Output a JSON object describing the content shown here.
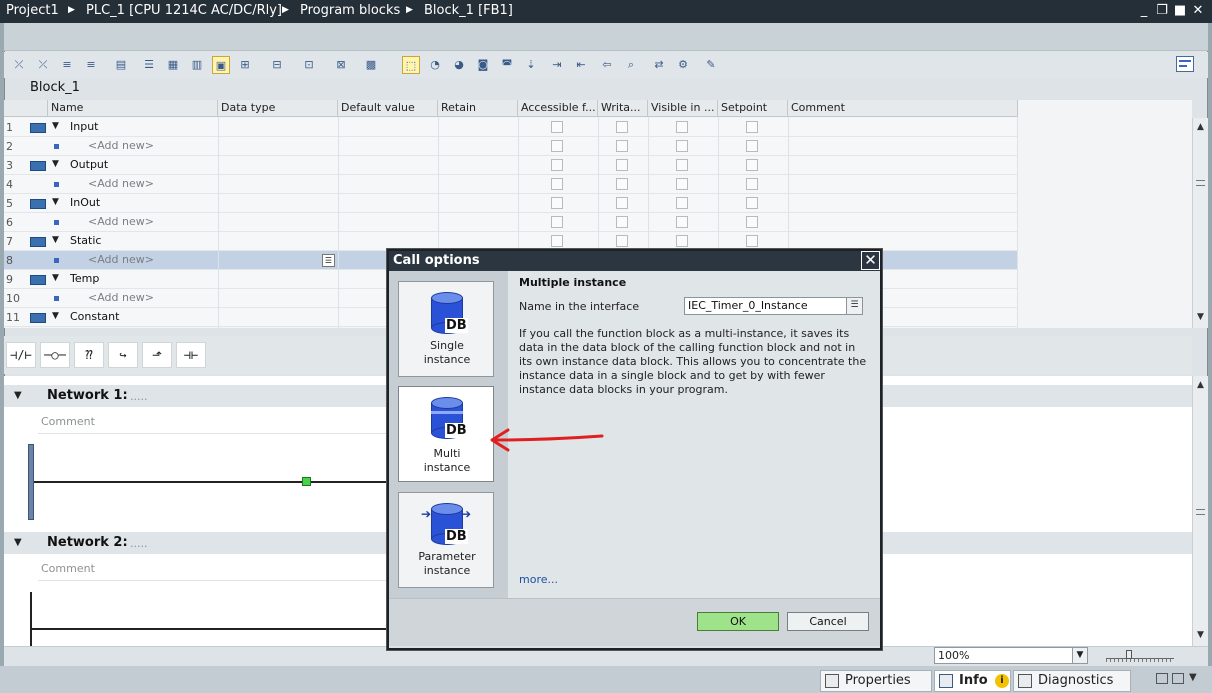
{
  "titlebar": {
    "crumbs": [
      "Project1",
      "PLC_1 [CPU 1214C AC/DC/Rly]",
      "Program blocks",
      "Block_1 [FB1]"
    ],
    "separator": "▶",
    "window_buttons": [
      "_",
      "❐",
      "■",
      "✕"
    ]
  },
  "toolbar": {
    "icons": [
      "delete-var-icon",
      "delete-var2-icon",
      "insert-row-icon",
      "add-row-icon",
      "open-plc-icon",
      "ladder-icon",
      "stl-icon",
      "fbd-icon",
      "comment-icon",
      "insert-network-icon",
      "delete-network-icon",
      "collapse-icon",
      "expand-icon",
      "absolute-display-icon",
      "favorites-icon",
      "monitor-icon",
      "set-value-icon",
      "modify-icon",
      "force-icon",
      "download-icon",
      "go-to-icon",
      "next-error-icon",
      "prev-error-icon",
      "find-icon",
      "replace-icon",
      "properties-icon",
      "edit-icon"
    ],
    "right_icon": "layout-icon"
  },
  "block_title": "Block_1",
  "interface": {
    "columns": [
      "Name",
      "Data type",
      "Default value",
      "Retain",
      "Accessible f...",
      "Writa...",
      "Visible in ...",
      "Setpoint",
      "Comment"
    ],
    "rows": [
      {
        "num": "1",
        "kind": "section",
        "name": "Input"
      },
      {
        "num": "2",
        "kind": "add",
        "name": "<Add new>"
      },
      {
        "num": "3",
        "kind": "section",
        "name": "Output"
      },
      {
        "num": "4",
        "kind": "add",
        "name": "<Add new>"
      },
      {
        "num": "5",
        "kind": "section",
        "name": "InOut"
      },
      {
        "num": "6",
        "kind": "add",
        "name": "<Add new>"
      },
      {
        "num": "7",
        "kind": "section",
        "name": "Static"
      },
      {
        "num": "8",
        "kind": "add",
        "name": "<Add new>",
        "selected": true
      },
      {
        "num": "9",
        "kind": "section",
        "name": "Temp"
      },
      {
        "num": "10",
        "kind": "add",
        "name": "<Add new>"
      },
      {
        "num": "11",
        "kind": "section",
        "name": "Constant"
      }
    ]
  },
  "ladder_palette": [
    "⊣/⊢",
    "─○─",
    "⁇",
    "↪",
    "⬏",
    "⊣⊢"
  ],
  "networks": [
    {
      "title": "Network 1:",
      "dots": ".....",
      "comment_placeholder": "Comment"
    },
    {
      "title": "Network 2:",
      "dots": ".....",
      "comment_placeholder": "Comment"
    }
  ],
  "zoom": {
    "value": "100%"
  },
  "bottom_tabs": [
    {
      "label": "Properties",
      "icon": "properties-icon"
    },
    {
      "label": "Info",
      "icon": "info-icon",
      "badge": "i"
    },
    {
      "label": "Diagnostics",
      "icon": "diagnostics-icon"
    }
  ],
  "dialog": {
    "title": "Call options",
    "close": "✕",
    "options": [
      {
        "label_line1": "Single",
        "label_line2": "instance",
        "icon": "db-single-icon"
      },
      {
        "label_line1": "Multi",
        "label_line2": "instance",
        "icon": "db-multi-icon",
        "selected": true
      },
      {
        "label_line1": "Parameter",
        "label_line2": "instance",
        "icon": "db-parameter-icon"
      }
    ],
    "db_label": "DB",
    "section_title": "Multiple instance",
    "name_label": "Name in the interface",
    "name_value": "IEC_Timer_0_Instance",
    "description": "If you call the function block as a multi-instance, it saves its data in the data block of the calling function block and not in its own instance data block. This allows you to concentrate the instance data in a single block and to get by with fewer instance data blocks in your program.",
    "more_link": "more...",
    "ok_label": "OK",
    "cancel_label": "Cancel"
  },
  "colors": {
    "title_bar": "#252f38",
    "ok_button": "#9ee389",
    "annotation_arrow": "#e02020",
    "db_blue": "#2a52d6"
  }
}
